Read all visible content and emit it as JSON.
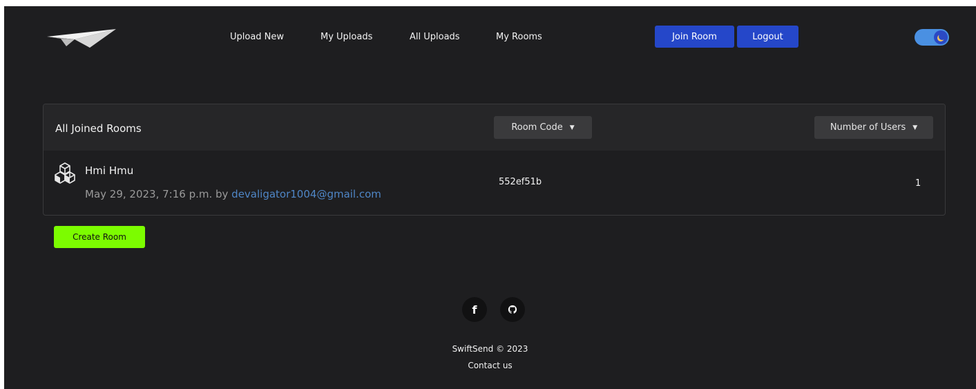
{
  "header": {
    "logo_icon": "paper-plane-icon",
    "nav": [
      {
        "label": "Upload New"
      },
      {
        "label": "My Uploads"
      },
      {
        "label": "All Uploads"
      },
      {
        "label": "My Rooms"
      }
    ],
    "join_room_label": "Join Room",
    "logout_label": "Logout",
    "theme_toggle_icon": "moon-icon"
  },
  "rooms_table": {
    "title": "All Joined Rooms",
    "col_room_code": "Room Code",
    "col_users": "Number of Users",
    "rows": [
      {
        "name": "Hmi Hmu",
        "date": "May 29, 2023, 7:16 p.m. by ",
        "owner": "devaligator1004@gmail.com",
        "code": "552ef51b",
        "users": "1"
      }
    ]
  },
  "create_room_label": "Create Room",
  "footer": {
    "copyright": "SwiftSend © 2023",
    "contact": "Contact us"
  },
  "colors": {
    "background": "#1e1e20",
    "primary_button": "#2547c9",
    "create_button": "#7cfc00",
    "link": "#4f86c6"
  }
}
